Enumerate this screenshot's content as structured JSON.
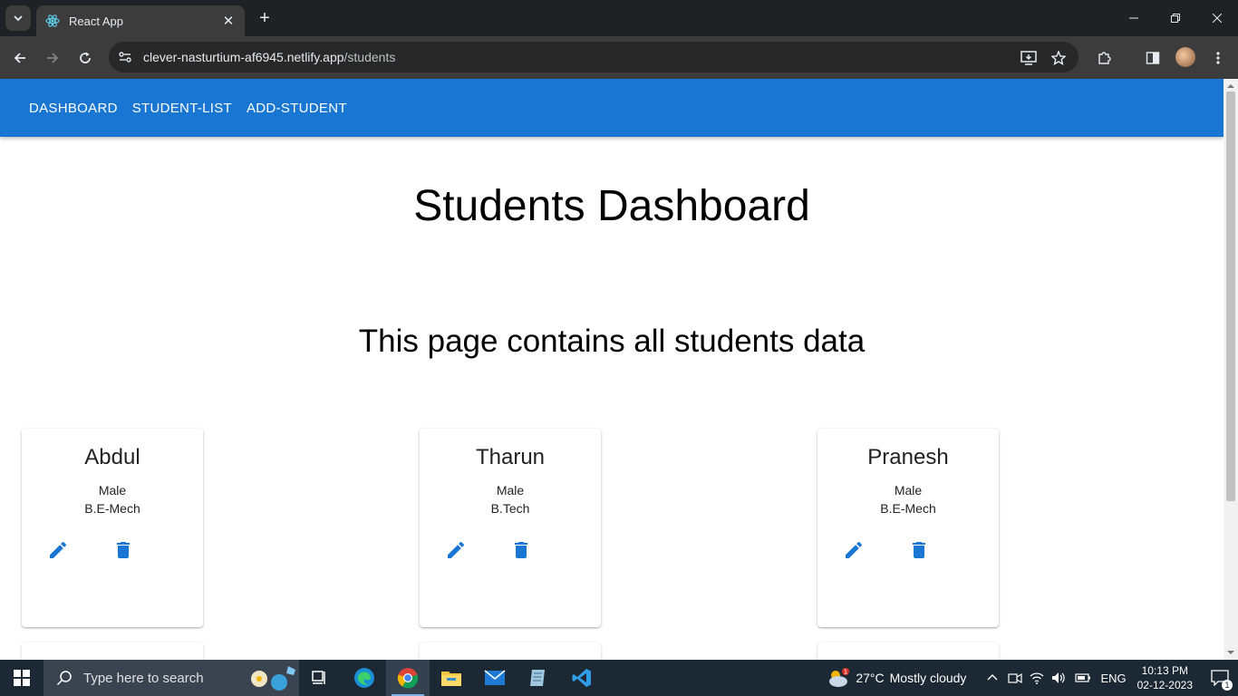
{
  "browser": {
    "tab_title": "React App",
    "tab_close": "✕",
    "new_tab": "+",
    "url_host": "clever-nasturtium-af6945.netlify.app",
    "url_path": "/students"
  },
  "nav": {
    "links": [
      "DASHBOARD",
      "STUDENT-LIST",
      "ADD-STUDENT"
    ]
  },
  "page": {
    "title": "Students Dashboard",
    "subtitle": "This page contains all students data"
  },
  "students": [
    {
      "name": "Abdul",
      "gender": "Male",
      "course": "B.E-Mech"
    },
    {
      "name": "Tharun",
      "gender": "Male",
      "course": "B.Tech"
    },
    {
      "name": "Pranesh",
      "gender": "Male",
      "course": "B.E-Mech"
    }
  ],
  "taskbar": {
    "search_placeholder": "Type here to search",
    "weather_temp": "27°C",
    "weather_desc": "Mostly cloudy",
    "lang": "ENG",
    "time": "10:13 PM",
    "date": "02-12-2023",
    "notifications": "1"
  },
  "colors": {
    "appbar": "#1976d2",
    "icon_blue": "#1976d2"
  }
}
